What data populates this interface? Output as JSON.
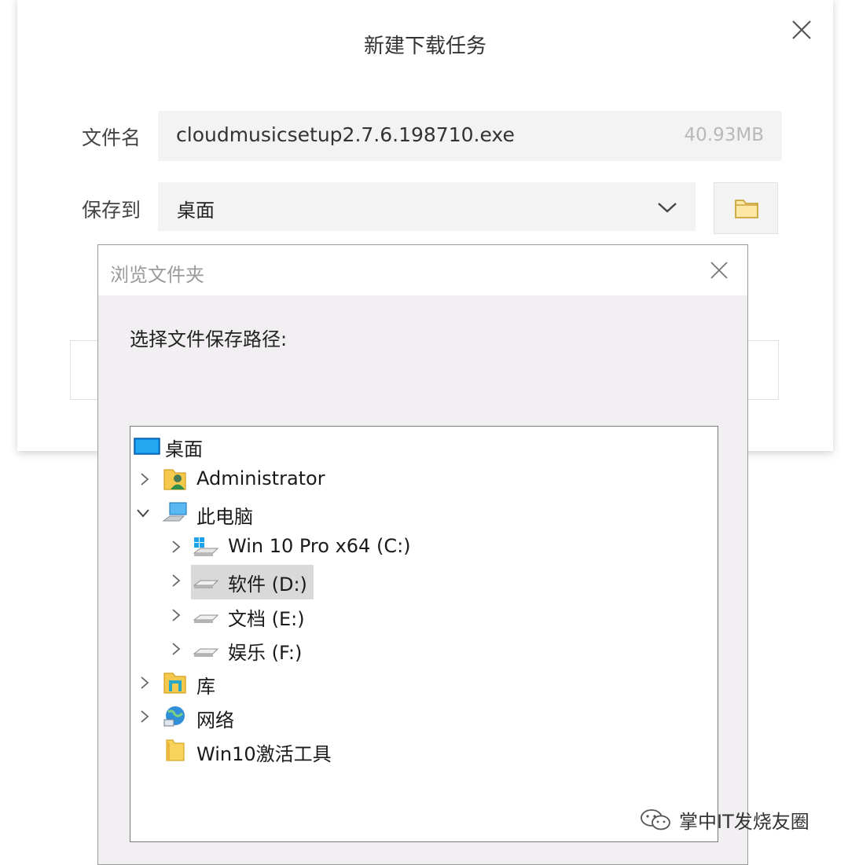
{
  "download_dialog": {
    "title": "新建下载任务",
    "filename_label": "文件名",
    "filename": "cloudmusicsetup2.7.6.198710.exe",
    "filesize": "40.93MB",
    "saveto_label": "保存到",
    "saveto_value": "桌面",
    "close_icon": "close-icon",
    "folder_icon": "folder-icon"
  },
  "browse_dialog": {
    "title": "浏览文件夹",
    "prompt": "选择文件保存路径:",
    "tree": [
      {
        "label": "桌面",
        "icon": "desktop-icon",
        "expander": "none"
      },
      {
        "label": "Administrator",
        "icon": "user-folder-icon",
        "expander": "collapsed"
      },
      {
        "label": "此电脑",
        "icon": "computer-icon",
        "expander": "expanded"
      },
      {
        "label": "Win 10 Pro x64 (C:)",
        "icon": "windows-drive-icon",
        "expander": "collapsed"
      },
      {
        "label": "软件 (D:)",
        "icon": "drive-icon",
        "expander": "collapsed",
        "selected": true
      },
      {
        "label": "文档 (E:)",
        "icon": "drive-icon",
        "expander": "collapsed"
      },
      {
        "label": "娱乐 (F:)",
        "icon": "drive-icon",
        "expander": "collapsed"
      },
      {
        "label": "库",
        "icon": "library-icon",
        "expander": "collapsed"
      },
      {
        "label": "网络",
        "icon": "network-icon",
        "expander": "collapsed"
      },
      {
        "label": "Win10激活工具",
        "icon": "folder-icon",
        "expander": "none"
      }
    ]
  },
  "watermark": {
    "text": "掌中IT发烧友圈"
  }
}
